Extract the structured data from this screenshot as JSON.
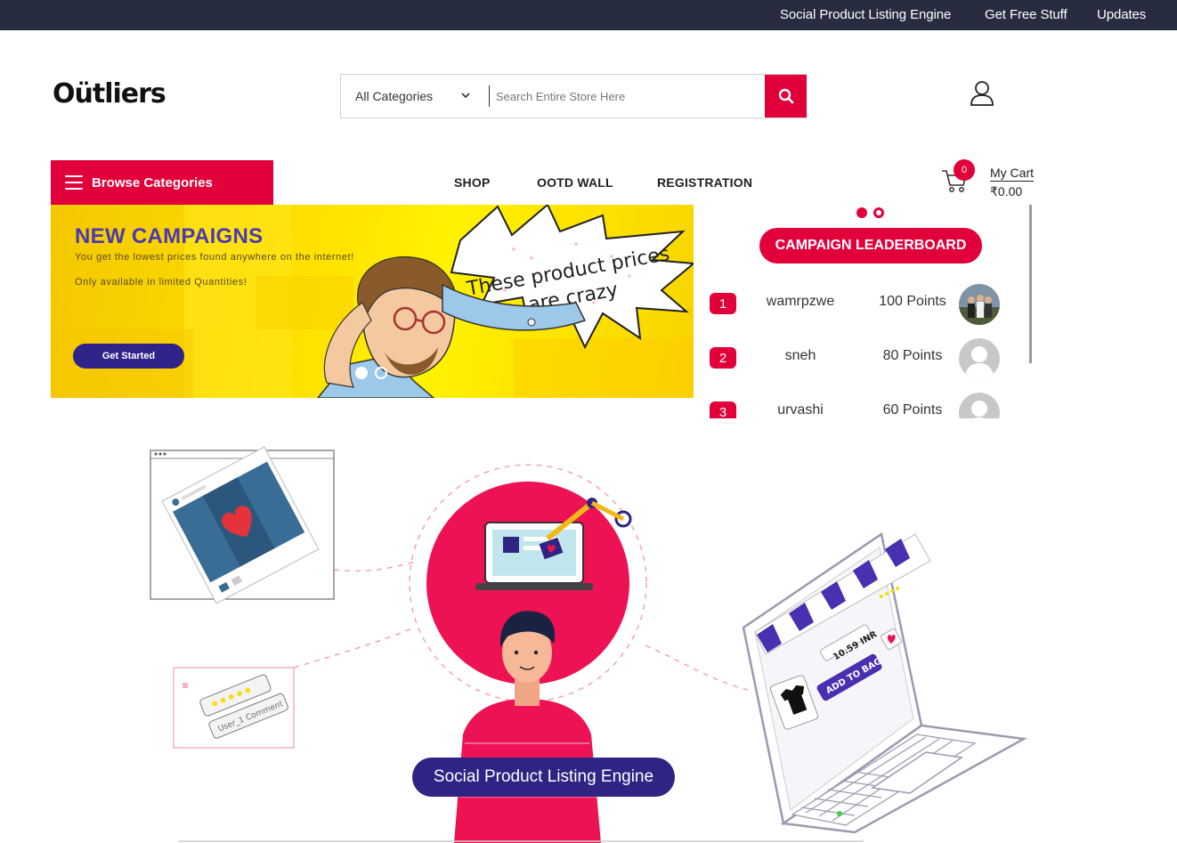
{
  "topbar": {
    "links": [
      "Social Product Listing Engine",
      "Get Free Stuff",
      "Updates"
    ]
  },
  "header": {
    "logo": "Oütliers",
    "category_select": "All Categories",
    "search_placeholder": "Search Entire Store Here"
  },
  "nav": {
    "browse_label": "Browse Categories",
    "links": [
      "SHOP",
      "OOTD WALL",
      "REGISTRATION"
    ]
  },
  "cart": {
    "count": "0",
    "label": "My Cart",
    "total": "₹0.00"
  },
  "banner": {
    "title": "NEW CAMPAIGNS",
    "line1": "You get the lowest prices found anywhere on the internet!",
    "line2": "Only available in limited Quantities!",
    "cta": "Get Started",
    "art_text_1": "These product prices",
    "art_text_2": "are crazy"
  },
  "leaderboard": {
    "title": "CAMPAIGN LEADERBOARD",
    "rows": [
      {
        "rank": "1",
        "name": "wamrpzwe",
        "points": "100 Points"
      },
      {
        "rank": "2",
        "name": "sneh",
        "points": "80 Points"
      },
      {
        "rank": "3",
        "name": "urvashi",
        "points": "60 Points"
      }
    ]
  },
  "hero": {
    "label": "Social Product Listing Engine",
    "price_tag": "10.59 INR",
    "add_to_bag": "ADD TO BAG",
    "comment_text": "User_1 Comment"
  },
  "colors": {
    "accent": "#e2003b",
    "topbar": "#272c40",
    "navy": "#30238a",
    "banner_title": "#4a3ab0"
  }
}
